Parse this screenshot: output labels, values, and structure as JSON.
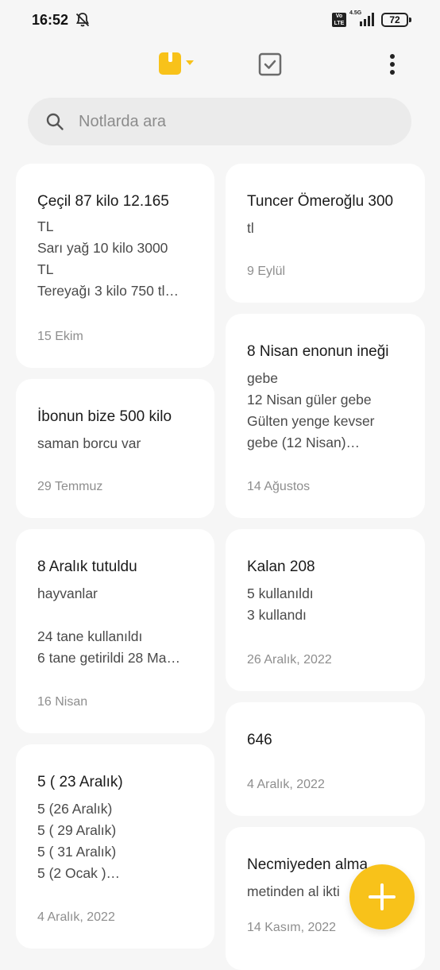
{
  "status_bar": {
    "time": "16:52",
    "network_badge": "Vo LTE",
    "network_type": "4.5G",
    "battery": "72"
  },
  "toolbar": {
    "notes_tab_icon": "notes-folder-icon",
    "todo_tab_icon": "checkbox-icon",
    "more_icon": "more-vertical-icon",
    "accent_color": "#f8c21a"
  },
  "search": {
    "placeholder": "Notlarda ara"
  },
  "notes": {
    "left": [
      {
        "title": "Çeçil 87 kilo 12.165",
        "body": "TL\nSarı yağ 10 kilo 3000\nTL\nTereyağı 3 kilo 750 tl…",
        "date": "15 Ekim"
      },
      {
        "title": "İbonun bize 500 kilo",
        "body": "saman borcu var",
        "date": "29 Temmuz"
      },
      {
        "title": "8 Aralık tutuldu",
        "body": "hayvanlar\n\n24 tane kullanıldı\n6 tane getirildi 28 Ma…",
        "date": "16 Nisan"
      },
      {
        "title": "5 ( 23 Aralık)",
        "body": "5 (26 Aralık)\n5 ( 29 Aralık)\n5 ( 31 Aralık)\n5 (2 Ocak )…",
        "date": "4 Aralık, 2022"
      }
    ],
    "right": [
      {
        "title": "Tuncer Ömeroğlu 300",
        "body": "tl",
        "date": "9 Eylül"
      },
      {
        "title": "8 Nisan enonun ineği",
        "body": "gebe\n12 Nisan güler gebe\nGülten yenge kevser\ngebe (12 Nisan)…",
        "date": "14 Ağustos"
      },
      {
        "title": "Kalan 208",
        "body": "5 kullanıldı\n3 kullandı",
        "date": "26 Aralık, 2022"
      },
      {
        "title": "646",
        "body": "",
        "date": "4 Aralık, 2022"
      },
      {
        "title": "Necmiyeden alma",
        "body": "metinden al ikti",
        "date": "14 Kasım, 2022"
      }
    ]
  },
  "fab": {
    "icon": "plus-icon"
  }
}
